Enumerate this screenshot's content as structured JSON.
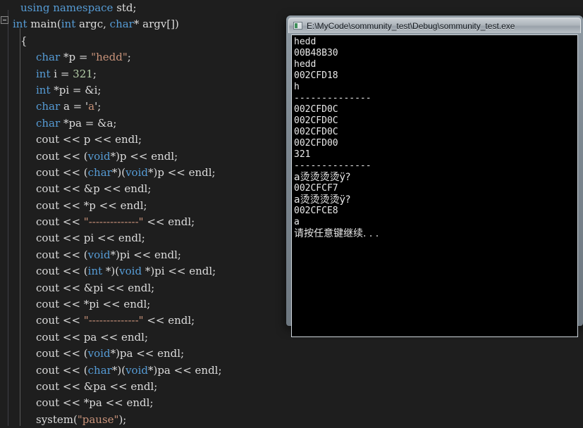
{
  "editor": {
    "collapse_icon": "minus-box-icon",
    "code_lines": [
      {
        "indent": 1,
        "tokens": [
          {
            "t": "using ",
            "c": "kw"
          },
          {
            "t": "namespace ",
            "c": "kw"
          },
          {
            "t": "std;",
            "c": "pl"
          }
        ]
      },
      {
        "indent": 0,
        "tokens": [
          {
            "t": "int ",
            "c": "kw"
          },
          {
            "t": "main(",
            "c": "pl"
          },
          {
            "t": "int ",
            "c": "kw"
          },
          {
            "t": "argc, ",
            "c": "pl"
          },
          {
            "t": "char",
            "c": "kw"
          },
          {
            "t": "* argv[])",
            "c": "pl"
          }
        ]
      },
      {
        "indent": 1,
        "tokens": [
          {
            "t": "{",
            "c": "pl"
          }
        ]
      },
      {
        "indent": 3,
        "tokens": [
          {
            "t": "char ",
            "c": "kw"
          },
          {
            "t": "*p = ",
            "c": "pl"
          },
          {
            "t": "\"hedd\"",
            "c": "str"
          },
          {
            "t": ";",
            "c": "pl"
          }
        ]
      },
      {
        "indent": 3,
        "tokens": [
          {
            "t": "int ",
            "c": "kw"
          },
          {
            "t": "i = ",
            "c": "pl"
          },
          {
            "t": "321",
            "c": "num"
          },
          {
            "t": ";",
            "c": "pl"
          }
        ]
      },
      {
        "indent": 3,
        "tokens": [
          {
            "t": "int ",
            "c": "kw"
          },
          {
            "t": "*pi = &i;",
            "c": "pl"
          }
        ]
      },
      {
        "indent": 3,
        "tokens": [
          {
            "t": "char ",
            "c": "kw"
          },
          {
            "t": "a = '",
            "c": "pl"
          },
          {
            "t": "a",
            "c": "str"
          },
          {
            "t": "';",
            "c": "pl"
          }
        ]
      },
      {
        "indent": 3,
        "tokens": [
          {
            "t": "char ",
            "c": "kw"
          },
          {
            "t": "*pa = &a;",
            "c": "pl"
          }
        ]
      },
      {
        "indent": 3,
        "tokens": [
          {
            "t": "cout << p << endl;",
            "c": "pl"
          }
        ]
      },
      {
        "indent": 3,
        "tokens": [
          {
            "t": "cout << (",
            "c": "pl"
          },
          {
            "t": "void",
            "c": "kw"
          },
          {
            "t": "*)p << endl;",
            "c": "pl"
          }
        ]
      },
      {
        "indent": 3,
        "tokens": [
          {
            "t": "cout << (",
            "c": "pl"
          },
          {
            "t": "char",
            "c": "kw"
          },
          {
            "t": "*)(",
            "c": "pl"
          },
          {
            "t": "void",
            "c": "kw"
          },
          {
            "t": "*)p << endl;",
            "c": "pl"
          }
        ]
      },
      {
        "indent": 3,
        "tokens": [
          {
            "t": "cout << &p << endl;",
            "c": "pl"
          }
        ]
      },
      {
        "indent": 3,
        "tokens": [
          {
            "t": "cout << *p << endl;",
            "c": "pl"
          }
        ]
      },
      {
        "indent": 3,
        "tokens": [
          {
            "t": "cout << ",
            "c": "pl"
          },
          {
            "t": "\"--------------\"",
            "c": "str"
          },
          {
            "t": " << endl;",
            "c": "pl"
          }
        ]
      },
      {
        "indent": 3,
        "tokens": [
          {
            "t": "cout << pi << endl;",
            "c": "pl"
          }
        ]
      },
      {
        "indent": 3,
        "tokens": [
          {
            "t": "cout << (",
            "c": "pl"
          },
          {
            "t": "void",
            "c": "kw"
          },
          {
            "t": "*)pi << endl;",
            "c": "pl"
          }
        ]
      },
      {
        "indent": 3,
        "tokens": [
          {
            "t": "cout << (",
            "c": "pl"
          },
          {
            "t": "int",
            "c": "kw"
          },
          {
            "t": " *)(",
            "c": "pl"
          },
          {
            "t": "void",
            "c": "kw"
          },
          {
            "t": " *)pi << endl;",
            "c": "pl"
          }
        ]
      },
      {
        "indent": 3,
        "tokens": [
          {
            "t": "cout << &pi << endl;",
            "c": "pl"
          }
        ]
      },
      {
        "indent": 3,
        "tokens": [
          {
            "t": "cout << *pi << endl;",
            "c": "pl"
          }
        ]
      },
      {
        "indent": 3,
        "tokens": [
          {
            "t": "cout << ",
            "c": "pl"
          },
          {
            "t": "\"--------------\"",
            "c": "str"
          },
          {
            "t": " << endl;",
            "c": "pl"
          }
        ]
      },
      {
        "indent": 3,
        "tokens": [
          {
            "t": "cout << pa << endl;",
            "c": "pl"
          }
        ]
      },
      {
        "indent": 3,
        "tokens": [
          {
            "t": "cout << (",
            "c": "pl"
          },
          {
            "t": "void",
            "c": "kw"
          },
          {
            "t": "*)pa << endl;",
            "c": "pl"
          }
        ]
      },
      {
        "indent": 3,
        "tokens": [
          {
            "t": "cout << (",
            "c": "pl"
          },
          {
            "t": "char",
            "c": "kw"
          },
          {
            "t": "*)(",
            "c": "pl"
          },
          {
            "t": "void",
            "c": "kw"
          },
          {
            "t": "*)pa << endl;",
            "c": "pl"
          }
        ]
      },
      {
        "indent": 3,
        "tokens": [
          {
            "t": "cout << &pa << endl;",
            "c": "pl"
          }
        ]
      },
      {
        "indent": 3,
        "tokens": [
          {
            "t": "cout << *pa << endl;",
            "c": "pl"
          }
        ]
      },
      {
        "indent": 3,
        "tokens": [
          {
            "t": "system(",
            "c": "pl"
          },
          {
            "t": "\"pause\"",
            "c": "str"
          },
          {
            "t": ");",
            "c": "pl"
          }
        ]
      }
    ]
  },
  "console": {
    "icon": "console-app-icon",
    "title": "E:\\MyCode\\sommunity_test\\Debug\\sommunity_test.exe",
    "output_lines": [
      "hedd",
      "00B48B30",
      "hedd",
      "002CFD18",
      "h",
      "--------------",
      "002CFD0C",
      "002CFD0C",
      "002CFD0C",
      "002CFD00",
      "321",
      "--------------",
      "a烫烫烫烫ÿ?",
      "002CFCF7",
      "a烫烫烫烫ÿ?",
      "002CFCE8",
      "a",
      "请按任意键继续. . ."
    ]
  },
  "colors": {
    "editor_bg": "#1e1e1e",
    "keyword": "#569cd6",
    "string": "#c9937a",
    "number": "#b5cea8",
    "plain_text": "#dcdcdc",
    "console_bg": "#000000",
    "console_text": "#e8e8e8"
  }
}
